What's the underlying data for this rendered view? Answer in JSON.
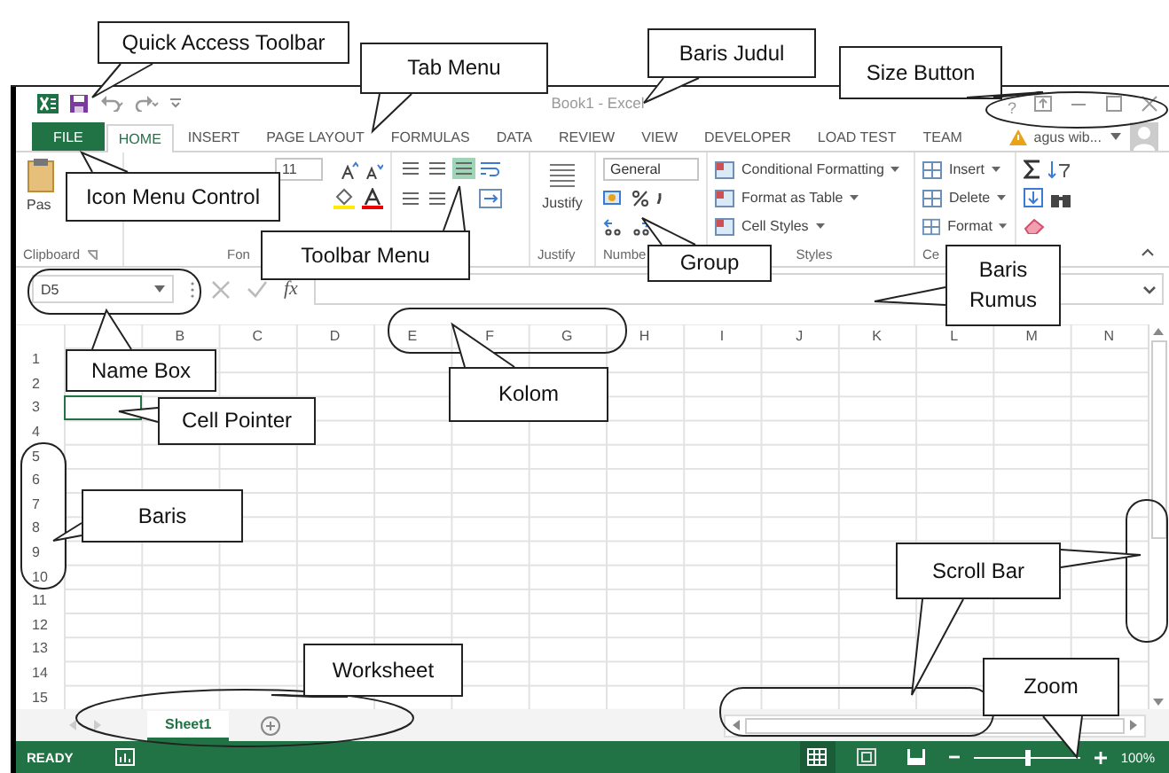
{
  "window": {
    "title": "Book1 - Excel",
    "help": "?"
  },
  "tabs": [
    {
      "label": "FILE",
      "kind": "file",
      "selected": false
    },
    {
      "label": "HOME",
      "kind": "tab",
      "selected": true
    },
    {
      "label": "INSERT",
      "kind": "tab",
      "selected": false
    },
    {
      "label": "PAGE LAYOUT",
      "kind": "tab",
      "selected": false
    },
    {
      "label": "FORMULAS",
      "kind": "tab",
      "selected": false
    },
    {
      "label": "DATA",
      "kind": "tab",
      "selected": false
    },
    {
      "label": "REVIEW",
      "kind": "tab",
      "selected": false
    },
    {
      "label": "VIEW",
      "kind": "tab",
      "selected": false
    },
    {
      "label": "DEVELOPER",
      "kind": "tab",
      "selected": false
    },
    {
      "label": "LOAD TEST",
      "kind": "tab",
      "selected": false
    },
    {
      "label": "TEAM",
      "kind": "tab",
      "selected": false
    }
  ],
  "account": {
    "name": "agus wib..."
  },
  "ribbon": {
    "paste_label": "Pas",
    "font_size": "11",
    "justify_label": "Justify",
    "number_format": "General",
    "styles": [
      "Conditional Formatting",
      "Format as Table",
      "Cell Styles"
    ],
    "cells": [
      "Insert",
      "Delete",
      "Format"
    ],
    "group_labels": {
      "clipboard": "Clipboard",
      "font": "Fon",
      "justify": "Justify",
      "number": "Numbe",
      "styles": "Styles",
      "cells": "Ce"
    }
  },
  "formula_bar": {
    "name_box": "D5",
    "fx": "fx"
  },
  "sheet": {
    "columns": [
      "B",
      "C",
      "D",
      "E",
      "F",
      "G",
      "H",
      "I",
      "J",
      "K",
      "L",
      "M",
      "N"
    ],
    "rows": [
      {
        "label": "1",
        "selected": false
      },
      {
        "label": "2",
        "selected": false
      },
      {
        "label": "3",
        "selected": true
      },
      {
        "label": "4",
        "selected": false
      },
      {
        "label": "5",
        "selected": false
      },
      {
        "label": "6",
        "selected": false
      },
      {
        "label": "7",
        "selected": false
      },
      {
        "label": "8",
        "selected": false
      },
      {
        "label": "9",
        "selected": false
      },
      {
        "label": "10",
        "selected": false
      },
      {
        "label": "11",
        "selected": false
      },
      {
        "label": "12",
        "selected": false
      },
      {
        "label": "13",
        "selected": false
      },
      {
        "label": "14",
        "selected": false
      },
      {
        "label": "15",
        "selected": false
      }
    ]
  },
  "sheet_tabs": [
    {
      "label": "Sheet1",
      "selected": true
    }
  ],
  "status_bar": {
    "mode": "READY",
    "zoom": {
      "level": 0.5,
      "reading": "100%"
    }
  },
  "callouts": [
    {
      "label": "Quick Access Toolbar"
    },
    {
      "label": "Tab Menu"
    },
    {
      "label": "Baris Judul"
    },
    {
      "label": "Size Button"
    },
    {
      "label": "Icon Menu Control"
    },
    {
      "label": "Toolbar Menu"
    },
    {
      "label": "Group"
    },
    {
      "label": "Baris Rumus"
    },
    {
      "label": "Name Box"
    },
    {
      "label": "Kolom"
    },
    {
      "label": "Cell Pointer"
    },
    {
      "label": "Baris"
    },
    {
      "label": "Worksheet"
    },
    {
      "label": "Scroll Bar"
    },
    {
      "label": "Zoom"
    }
  ]
}
